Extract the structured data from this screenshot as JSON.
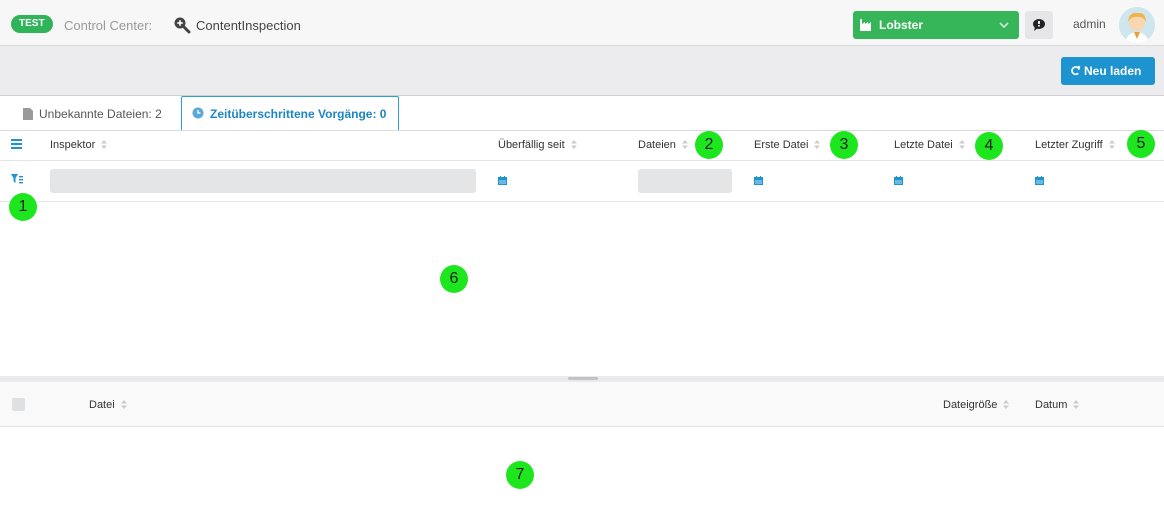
{
  "header": {
    "env_badge": "TEST",
    "app_label": "Control Center:",
    "page_title": "ContentInspection",
    "tenant": "Lobster",
    "user": "admin"
  },
  "toolbar": {
    "reload_label": "Neu laden"
  },
  "tabs": [
    {
      "label": "Unbekannte Dateien: 2",
      "active": false
    },
    {
      "label": "Zeitüberschrittene Vorgänge: 0",
      "active": true
    }
  ],
  "grid": {
    "columns": [
      "Inspektor",
      "Überfällig seit",
      "Dateien",
      "Erste Datei",
      "Letzte Datei",
      "Letzter Zugriff"
    ]
  },
  "files_grid": {
    "columns": [
      "Datei",
      "Dateigröße",
      "Datum"
    ]
  },
  "markers": [
    "1",
    "2",
    "3",
    "4",
    "5",
    "6",
    "7"
  ],
  "colors": {
    "accent": "#1d93d0",
    "tenant_green": "#37b559",
    "badge_green": "#2fb45a",
    "marker_green": "#1ee61e"
  }
}
